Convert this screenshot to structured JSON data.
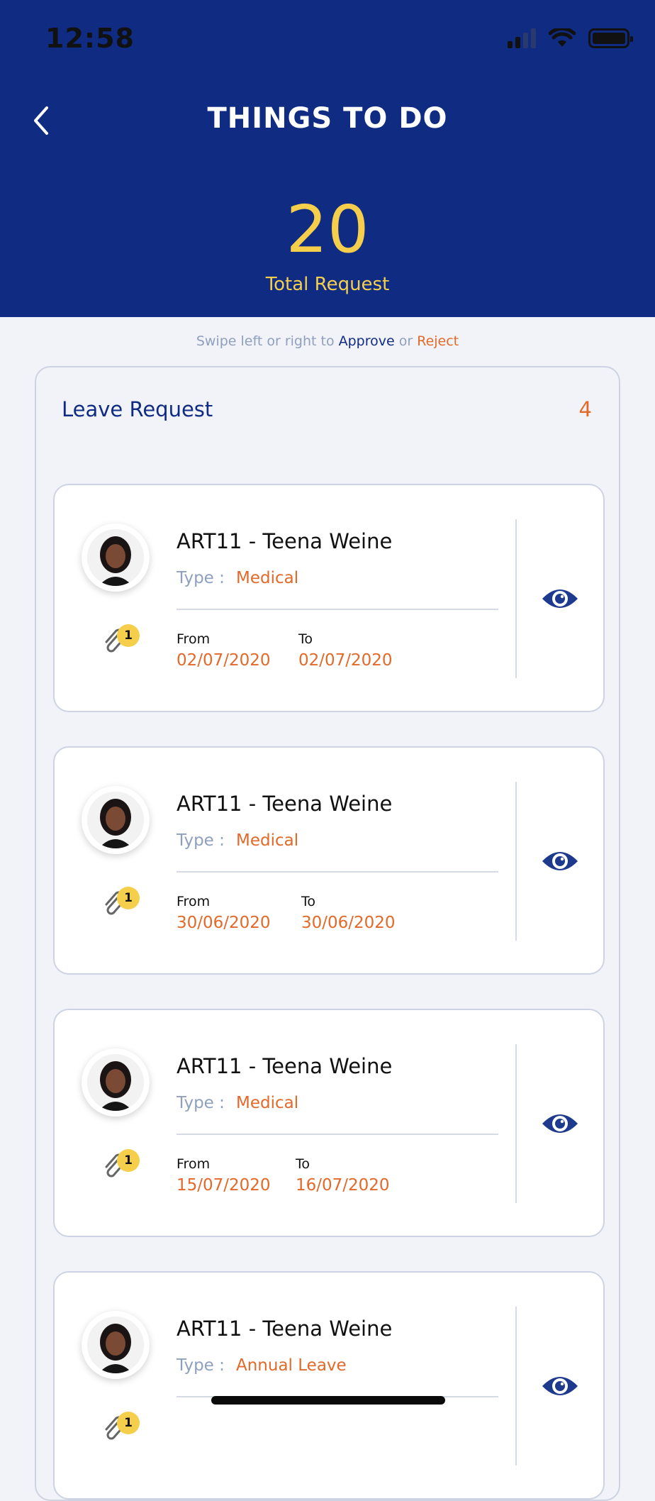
{
  "status_bar": {
    "time": "12:58"
  },
  "header": {
    "title": "THINGS TO DO",
    "total_count": "20",
    "total_label": "Total Request"
  },
  "hint": {
    "prefix": "Swipe left or right to ",
    "approve": "Approve",
    "middle": " or ",
    "reject": "Reject"
  },
  "section": {
    "title": "Leave Request",
    "count": "4"
  },
  "labels": {
    "type": "Type :",
    "from": "From",
    "to": "To"
  },
  "requests": [
    {
      "name": "ART11 - Teena Weine",
      "type": "Medical",
      "from": "02/07/2020",
      "to": "02/07/2020",
      "attachments": "1"
    },
    {
      "name": "ART11 - Teena Weine",
      "type": "Medical",
      "from": "30/06/2020",
      "to": "30/06/2020",
      "attachments": "1"
    },
    {
      "name": "ART11 - Teena Weine",
      "type": "Medical",
      "from": "15/07/2020",
      "to": "16/07/2020",
      "attachments": "1"
    },
    {
      "name": "ART11 - Teena Weine",
      "type": "Annual Leave",
      "from": "",
      "to": "",
      "attachments": "1"
    }
  ],
  "colors": {
    "navy": "#102C82",
    "yellow": "#F5CF4C",
    "orange": "#E2692A",
    "background": "#F1F3F8"
  },
  "icons": {
    "back": "chevron-left-icon",
    "attachment": "paperclip-icon",
    "view": "eye-icon"
  }
}
